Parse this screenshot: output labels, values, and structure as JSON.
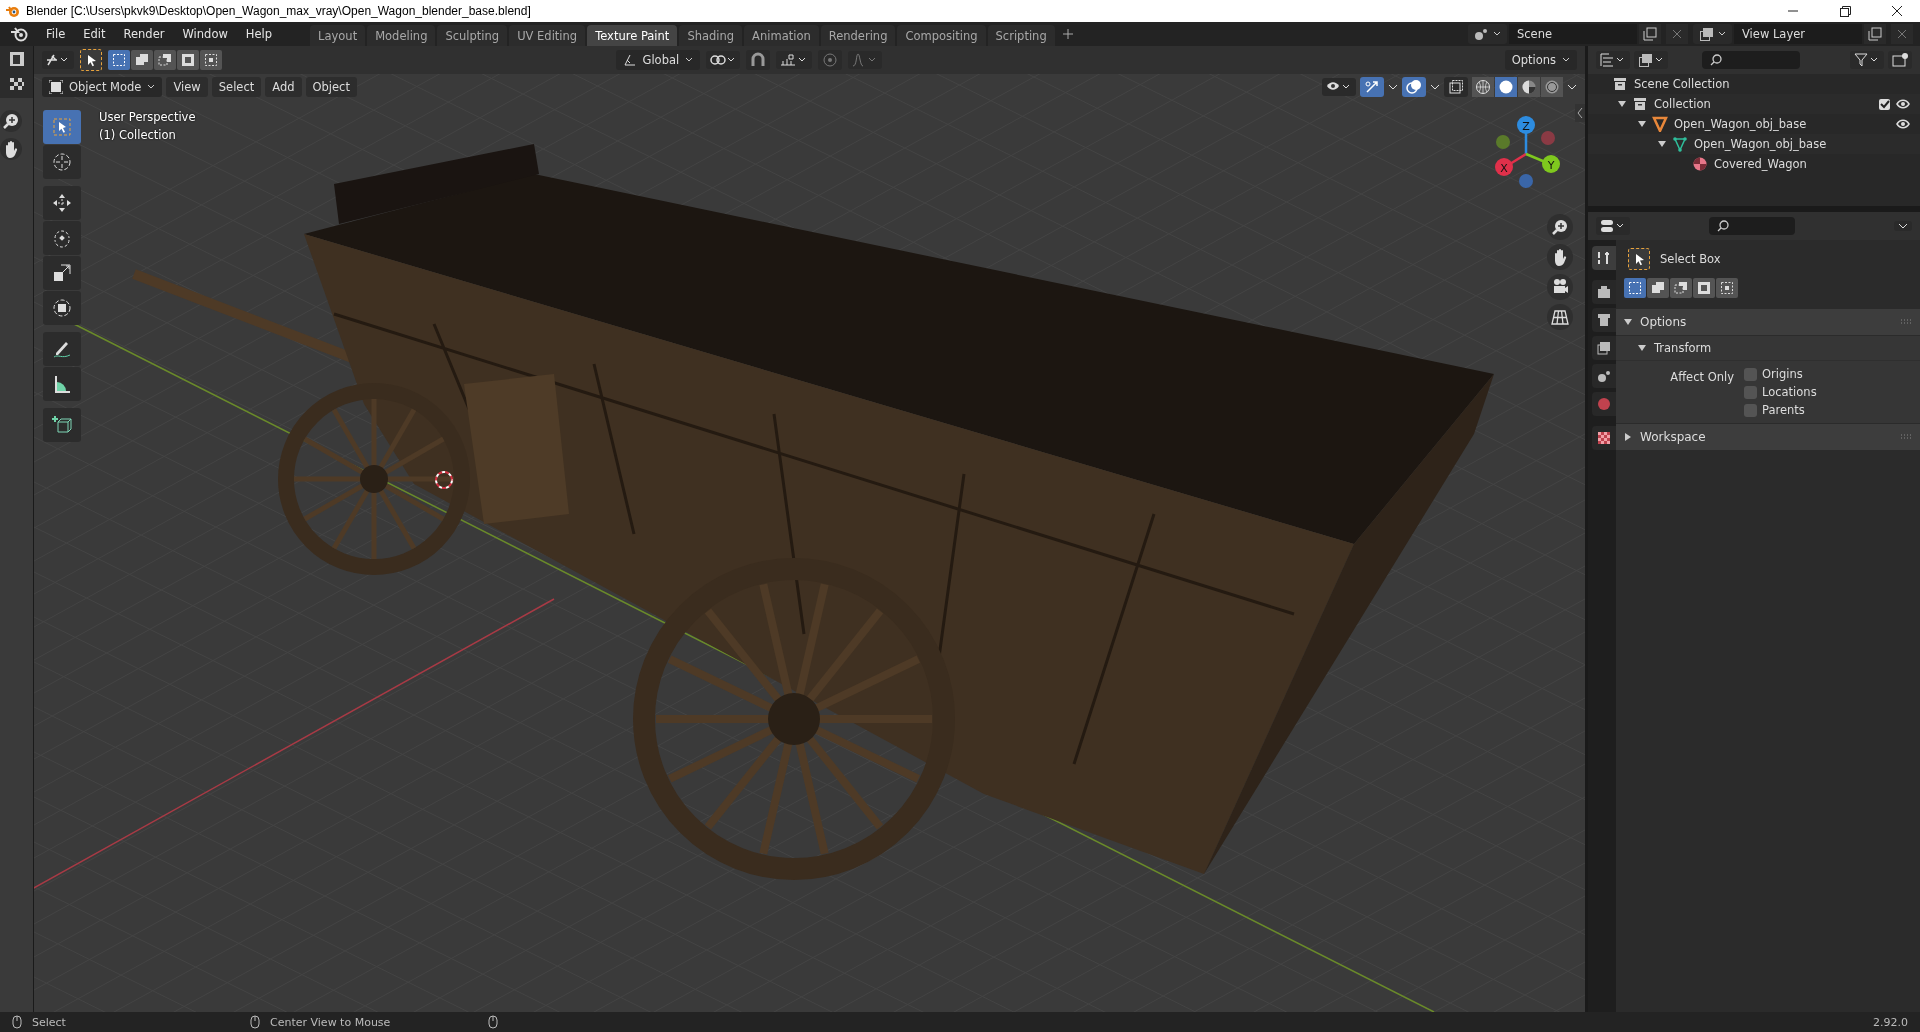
{
  "window": {
    "title": "Blender [C:\\Users\\pkvk9\\Desktop\\Open_Wagon_max_vray\\Open_Wagon_blender_base.blend]"
  },
  "menus": [
    "File",
    "Edit",
    "Render",
    "Window",
    "Help"
  ],
  "workspace_tabs": [
    {
      "label": "Layout",
      "selected": false
    },
    {
      "label": "Modeling",
      "selected": false
    },
    {
      "label": "Sculpting",
      "selected": false
    },
    {
      "label": "UV Editing",
      "selected": false
    },
    {
      "label": "Texture Paint",
      "selected": true
    },
    {
      "label": "Shading",
      "selected": false
    },
    {
      "label": "Animation",
      "selected": false
    },
    {
      "label": "Rendering",
      "selected": false
    },
    {
      "label": "Compositing",
      "selected": false
    },
    {
      "label": "Scripting",
      "selected": false
    }
  ],
  "scene": "Scene",
  "view_layer": "View Layer",
  "select_modes": [
    {
      "selected": true
    },
    {
      "selected": false
    },
    {
      "selected": false
    },
    {
      "selected": false
    },
    {
      "selected": false
    }
  ],
  "tool_header": {
    "orientation": "Global",
    "options": "Options"
  },
  "viewport_header": {
    "mode": "Object Mode",
    "menus": [
      "View",
      "Select",
      "Add",
      "Object"
    ],
    "shading": [
      {
        "kind": "wireframe",
        "selected": false
      },
      {
        "kind": "solid",
        "selected": true
      },
      {
        "kind": "material",
        "selected": false
      },
      {
        "kind": "rendered",
        "selected": false
      }
    ]
  },
  "viewport": {
    "view_name": "User Perspective",
    "collection": "(1) Collection",
    "gizmo_axes": [
      "X",
      "Y",
      "Z"
    ]
  },
  "tools": [
    {
      "kind": "select",
      "selected": true
    },
    {
      "kind": "cursor",
      "selected": false
    },
    {
      "kind": "move",
      "selected": false
    },
    {
      "kind": "rotate",
      "selected": false
    },
    {
      "kind": "scale",
      "selected": false
    },
    {
      "kind": "transform",
      "selected": false
    },
    {
      "kind": "annotate",
      "selected": false
    },
    {
      "kind": "measure",
      "selected": false
    },
    {
      "kind": "add-cube",
      "selected": false
    }
  ],
  "outliner": {
    "root": {
      "label": "Scene Collection",
      "kind": "scene",
      "children": [
        {
          "label": "Collection",
          "kind": "collection",
          "expanded": true,
          "checked": true,
          "visible": true,
          "children": [
            {
              "label": "Open_Wagon_obj_base",
              "kind": "object",
              "expanded": true,
              "visible": true,
              "children": [
                {
                  "label": "Open_Wagon_obj_base",
                  "kind": "mesh",
                  "expanded": true,
                  "children": [
                    {
                      "label": "Covered_Wagon",
                      "kind": "material"
                    }
                  ]
                }
              ]
            }
          ]
        }
      ]
    }
  },
  "properties": {
    "tabs": [
      {
        "kind": "tool",
        "selected": true
      },
      {
        "kind": "render",
        "selected": false
      },
      {
        "kind": "output",
        "selected": false
      },
      {
        "kind": "view-layer",
        "selected": false
      },
      {
        "kind": "scene",
        "selected": false
      },
      {
        "kind": "world",
        "selected": false
      },
      {
        "kind": "texture",
        "selected": false
      }
    ],
    "tool_name": "Select Box",
    "select_modes": [
      {
        "selected": true
      },
      {
        "selected": false
      },
      {
        "selected": false
      },
      {
        "selected": false
      },
      {
        "selected": false
      }
    ],
    "panels": [
      {
        "title": "Options",
        "expanded": true,
        "subpanels": [
          {
            "title": "Transform",
            "expanded": true,
            "label": "Affect Only",
            "checkboxes": [
              {
                "label": "Origins",
                "checked": false
              },
              {
                "label": "Locations",
                "checked": false
              },
              {
                "label": "Parents",
                "checked": false
              }
            ]
          }
        ]
      },
      {
        "title": "Workspace",
        "expanded": false
      }
    ]
  },
  "status_bar": {
    "items": [
      "Select",
      "Center View to Mouse"
    ],
    "version": "2.92.0"
  }
}
